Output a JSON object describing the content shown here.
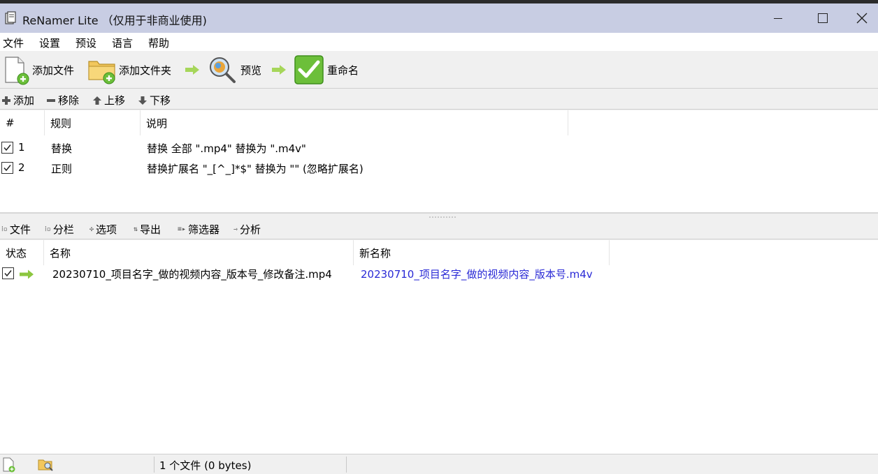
{
  "window": {
    "title": "ReNamer Lite （仅用于非商业使用)"
  },
  "menu": [
    "文件",
    "设置",
    "预设",
    "语言",
    "帮助"
  ],
  "toolbar": {
    "add_files": "添加文件",
    "add_folder": "添加文件夹",
    "preview": "预览",
    "rename": "重命名"
  },
  "rules_toolbar": {
    "add": "添加",
    "remove": "移除",
    "up": "上移",
    "down": "下移"
  },
  "rules": {
    "headers": {
      "num": "#",
      "rule": "规则",
      "desc": "说明"
    },
    "rows": [
      {
        "checked": true,
        "num": "1",
        "rule": "替换",
        "desc": "替换 全部 \".mp4\" 替换为 \".m4v\""
      },
      {
        "checked": true,
        "num": "2",
        "rule": "正则",
        "desc": "替换扩展名 \"_[^_]*$\" 替换为 \"\" (忽略扩展名)"
      }
    ]
  },
  "files_toolbar": {
    "files": "文件",
    "columns": "分栏",
    "options": "选项",
    "export": "导出",
    "filter": "筛选器",
    "analyze": "分析"
  },
  "files": {
    "headers": {
      "state": "状态",
      "name": "名称",
      "new_name": "新名称"
    },
    "rows": [
      {
        "checked": true,
        "name": "20230710_项目名字_做的视频内容_版本号_修改备注.mp4",
        "new_name": "20230710_项目名字_做的视频内容_版本号.m4v"
      }
    ]
  },
  "status": {
    "text": "1 个文件 (0 bytes)"
  },
  "colors": {
    "titlebar": "#c8cde3",
    "new_name": "#2a2ad6",
    "arrow_green": "#8cc63f"
  }
}
